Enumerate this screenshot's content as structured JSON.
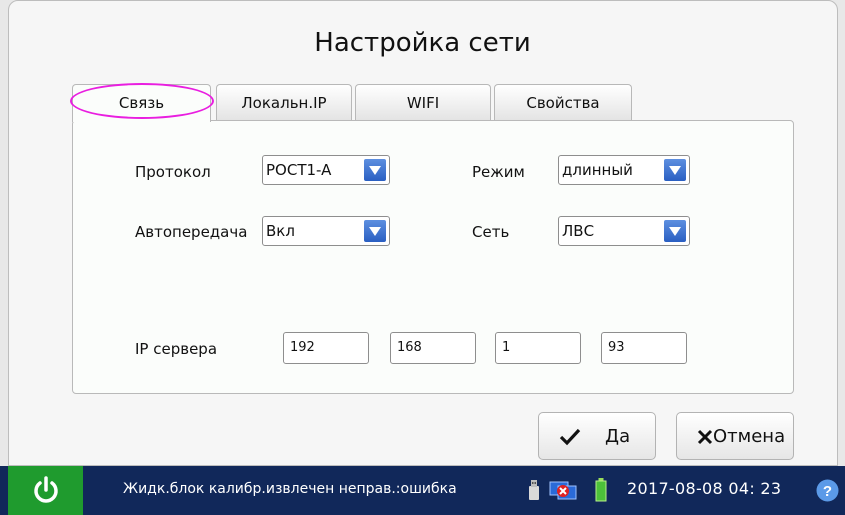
{
  "dialog": {
    "title": "Настройка сети",
    "tabs": [
      {
        "label": "Связь",
        "active": true
      },
      {
        "label": "Локальн.IP",
        "active": false
      },
      {
        "label": "WIFI",
        "active": false
      },
      {
        "label": "Свойства",
        "active": false
      }
    ],
    "fields": {
      "protocol": {
        "label": "Протокол",
        "value": "POCT1-A"
      },
      "mode": {
        "label": "Режим",
        "value": "длинный"
      },
      "autotransfer": {
        "label": "Автопередача",
        "value": "Вкл"
      },
      "network": {
        "label": "Сеть",
        "value": "ЛВС"
      },
      "server_ip": {
        "label": "IP сервера",
        "octets": [
          "192",
          "168",
          "1",
          "93"
        ]
      }
    },
    "buttons": {
      "ok_label": "Да",
      "cancel_label": "Отмена"
    }
  },
  "status_bar": {
    "message": "Жидк.блок калибр.извлечен неправ.:ошибка",
    "datetime": "2017-08-08 04: 23",
    "icons": [
      "power-icon",
      "usb-icon",
      "network-disconnected-icon",
      "battery-icon",
      "help-icon"
    ]
  },
  "colors": {
    "status_bar": "#11285a",
    "power_button": "#1f9b2e",
    "dropdown_arrow": "#3b6fd0",
    "tab_highlight": "#e91ee0"
  }
}
